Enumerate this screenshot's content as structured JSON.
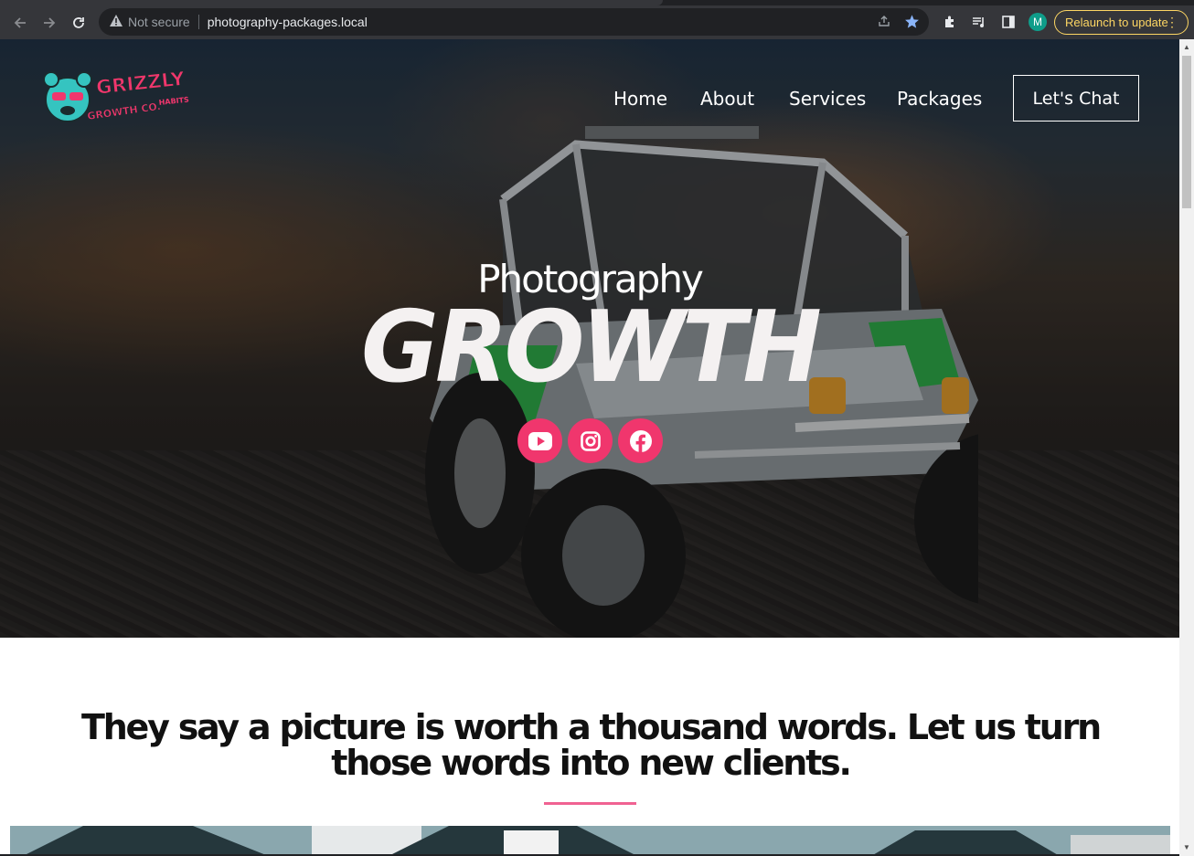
{
  "browser": {
    "security_label": "Not secure",
    "url": "photography-packages.local",
    "profile_initial": "M",
    "relaunch_label": "Relaunch to update"
  },
  "logo": {
    "line1": "GRIZZLY",
    "line2": "HABITS",
    "line3": "GROWTH CO."
  },
  "nav": {
    "items": [
      "Home",
      "About",
      "Services",
      "Packages"
    ],
    "cta": "Let's Chat"
  },
  "hero": {
    "title": "Photography",
    "brush_word": "GROWTH",
    "socials": [
      "youtube-icon",
      "instagram-icon",
      "facebook-icon"
    ]
  },
  "section": {
    "tagline": "They say a picture is worth a thousand words. Let us turn those words into new clients."
  },
  "colors": {
    "accent": "#f0366d",
    "divider": "#f06292",
    "logo_teal": "#35c4c0"
  }
}
